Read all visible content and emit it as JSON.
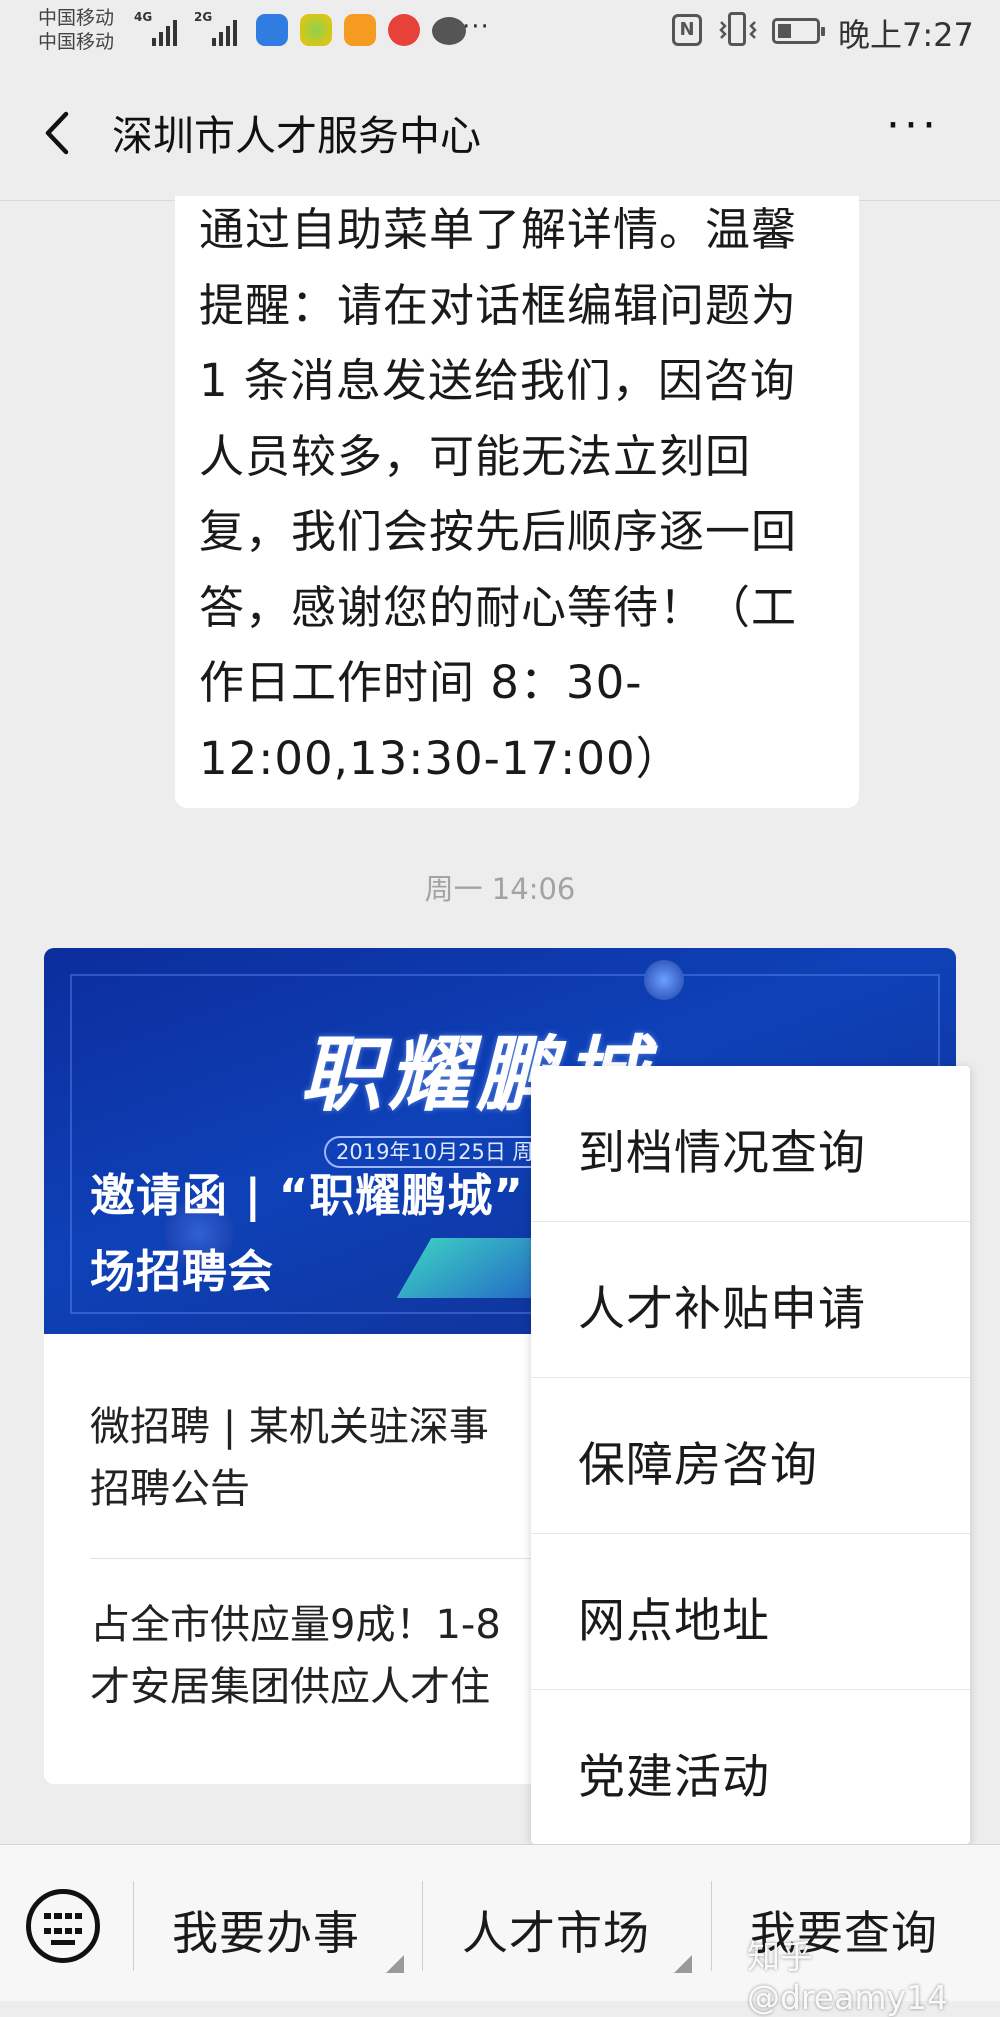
{
  "status_bar": {
    "carrier_top": "中国移动",
    "carrier_bottom": "中国移动",
    "net_1": "4G",
    "net_2": "2G",
    "app_icons": [
      "shield-app-icon",
      "sprout-app-icon",
      "orange-app-icon",
      "music-app-icon",
      "chat-app-icon"
    ],
    "overflow": "···",
    "nfc": "N",
    "time": "晚上7:27",
    "battery_level": 0.35
  },
  "header": {
    "title": "深圳市人才服务中心",
    "more": "···"
  },
  "message": {
    "text": "通过自助菜单了解详情。温馨提醒：请在对话框编辑问题为 1 条消息发送给我们，因咨询人员较多，可能无法立刻回复，我们会按先后顺序逐一回答，感谢您的耐心等待！（工作日工作时间 8：30-12:00,13:30-17:00）"
  },
  "timestamp": "周一 14:06",
  "card": {
    "banner_text": "职耀鹏城",
    "banner_date": "2019年10月25日 周五",
    "title": "邀请函 | “职耀鹏城”\n场招聘会",
    "items": [
      "微招聘 | 某机关驻深事\n招聘公告",
      "占全市供应量9成！1-8\n才安居集团供应人才住"
    ]
  },
  "popup_menu": {
    "items": [
      "到档情况查询",
      "人才补贴申请",
      "保障房咨询",
      "网点地址",
      "党建活动"
    ]
  },
  "bottom_menu": {
    "items": [
      "我要办事",
      "人才市场",
      "我要查询"
    ]
  },
  "watermark": "知乎 @dreamy14"
}
